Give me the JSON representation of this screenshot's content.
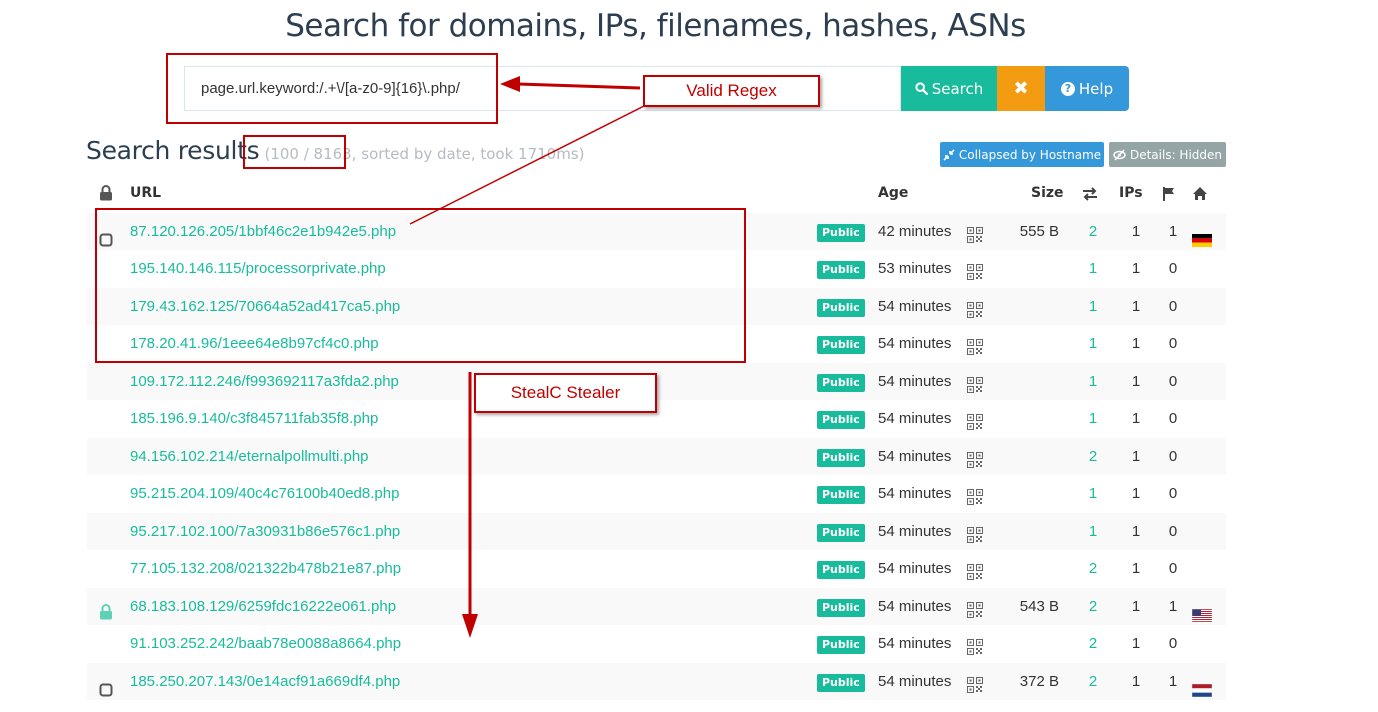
{
  "header": {
    "title": "Search for domains, IPs, filenames, hashes, ASNs"
  },
  "search": {
    "value": "page.url.keyword:/.+\\/[a-z0-9]{16}\\.php/",
    "search_label": "Search",
    "clear_label": "✖",
    "help_label": "Help"
  },
  "results": {
    "title": "Search results",
    "count": "(100 / 8163",
    "meta_rest": ", sorted by date, took 1710ms)",
    "collapsed_label": "Collapsed by Hostname",
    "details_label": "Details: Hidden"
  },
  "table": {
    "headers": {
      "url": "URL",
      "age": "Age",
      "size": "Size",
      "ips": "IPs"
    },
    "rows": [
      {
        "lock": "square",
        "url": "87.120.126.205/1bbf46c2e1b942e5.php",
        "badge": "Public",
        "age": "42 minutes",
        "size": "555 B",
        "redirects": "2",
        "ips": "1",
        "flags": "1",
        "country": "de"
      },
      {
        "lock": "",
        "url": "195.140.146.115/processorprivate.php",
        "badge": "Public",
        "age": "53 minutes",
        "size": "",
        "redirects": "1",
        "ips": "1",
        "flags": "0",
        "country": ""
      },
      {
        "lock": "",
        "url": "179.43.162.125/70664a52ad417ca5.php",
        "badge": "Public",
        "age": "54 minutes",
        "size": "",
        "redirects": "1",
        "ips": "1",
        "flags": "0",
        "country": ""
      },
      {
        "lock": "",
        "url": "178.20.41.96/1eee64e8b97cf4c0.php",
        "badge": "Public",
        "age": "54 minutes",
        "size": "",
        "redirects": "1",
        "ips": "1",
        "flags": "0",
        "country": ""
      },
      {
        "lock": "",
        "url": "109.172.112.246/f993692117a3fda2.php",
        "badge": "Public",
        "age": "54 minutes",
        "size": "",
        "redirects": "1",
        "ips": "1",
        "flags": "0",
        "country": ""
      },
      {
        "lock": "",
        "url": "185.196.9.140/c3f845711fab35f8.php",
        "badge": "Public",
        "age": "54 minutes",
        "size": "",
        "redirects": "1",
        "ips": "1",
        "flags": "0",
        "country": ""
      },
      {
        "lock": "",
        "url": "94.156.102.214/eternalpollmulti.php",
        "badge": "Public",
        "age": "54 minutes",
        "size": "",
        "redirects": "2",
        "ips": "1",
        "flags": "0",
        "country": ""
      },
      {
        "lock": "",
        "url": "95.215.204.109/40c4c76100b40ed8.php",
        "badge": "Public",
        "age": "54 minutes",
        "size": "",
        "redirects": "1",
        "ips": "1",
        "flags": "0",
        "country": ""
      },
      {
        "lock": "",
        "url": "95.217.102.100/7a30931b86e576c1.php",
        "badge": "Public",
        "age": "54 minutes",
        "size": "",
        "redirects": "1",
        "ips": "1",
        "flags": "0",
        "country": ""
      },
      {
        "lock": "",
        "url": "77.105.132.208/021322b478b21e87.php",
        "badge": "Public",
        "age": "54 minutes",
        "size": "",
        "redirects": "2",
        "ips": "1",
        "flags": "0",
        "country": ""
      },
      {
        "lock": "green",
        "url": "68.183.108.129/6259fdc16222e061.php",
        "badge": "Public",
        "age": "54 minutes",
        "size": "543 B",
        "redirects": "2",
        "ips": "1",
        "flags": "1",
        "country": "us"
      },
      {
        "lock": "",
        "url": "91.103.252.242/baab78e0088a8664.php",
        "badge": "Public",
        "age": "54 minutes",
        "size": "",
        "redirects": "2",
        "ips": "1",
        "flags": "0",
        "country": ""
      },
      {
        "lock": "square",
        "url": "185.250.207.143/0e14acf91a669df4.php",
        "badge": "Public",
        "age": "54 minutes",
        "size": "372 B",
        "redirects": "2",
        "ips": "1",
        "flags": "1",
        "country": "nl"
      }
    ]
  },
  "annotations": {
    "regex_label": "Valid Regex",
    "stealer_label": "StealC Stealer"
  },
  "colors": {
    "accent": "#18bc9c",
    "info": "#3498db",
    "warning": "#f39c12",
    "annotation": "#c00000"
  }
}
